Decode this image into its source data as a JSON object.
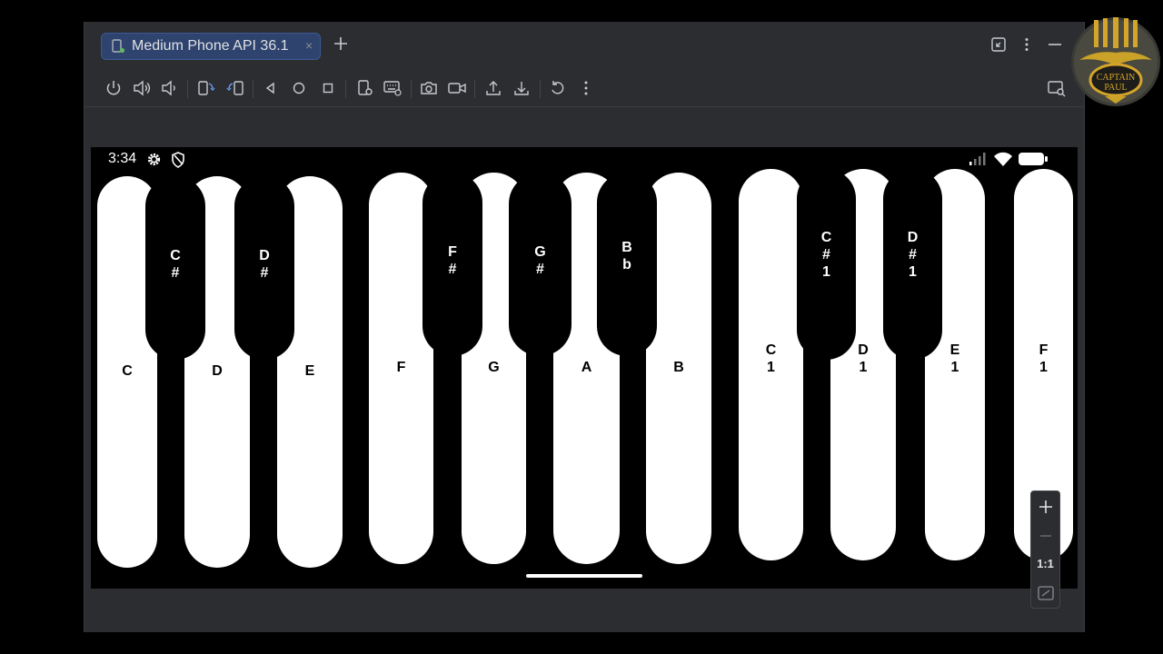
{
  "tab": {
    "title": "Medium Phone API 36.1",
    "close_glyph": "×",
    "add_glyph": "+"
  },
  "window_controls": [
    "restore-window-icon",
    "more-vert-icon",
    "minimize-icon"
  ],
  "toolbar": {
    "buttons": [
      "power-icon",
      "volume-up-icon",
      "volume-down-icon",
      "rotate-left-icon",
      "rotate-right-icon",
      "back-icon",
      "home-icon",
      "overview-icon",
      "device-settings-icon",
      "keyboard-icon",
      "camera-icon",
      "screen-record-icon",
      "export-icon",
      "import-icon",
      "reset-icon",
      "more-vert-icon",
      "device-mirroring-icon"
    ]
  },
  "status_bar": {
    "time": "3:34",
    "left_icons": [
      "settings-icon",
      "shield-icon"
    ],
    "right_icons": [
      "signal-icon",
      "wifi-icon",
      "battery-icon"
    ]
  },
  "piano": {
    "white_keys": [
      {
        "label": "C",
        "label_lines": [
          "C"
        ]
      },
      {
        "label": "D",
        "label_lines": [
          "D"
        ]
      },
      {
        "label": "E",
        "label_lines": [
          "E"
        ]
      },
      {
        "label": "F",
        "label_lines": [
          "F"
        ]
      },
      {
        "label": "G",
        "label_lines": [
          "G"
        ]
      },
      {
        "label": "A",
        "label_lines": [
          "A"
        ]
      },
      {
        "label": "B",
        "label_lines": [
          "B"
        ]
      },
      {
        "label": "C1",
        "label_lines": [
          "C",
          "1"
        ]
      },
      {
        "label": "D1",
        "label_lines": [
          "D",
          "1"
        ]
      },
      {
        "label": "E1",
        "label_lines": [
          "E",
          "1"
        ]
      },
      {
        "label": "F1",
        "label_lines": [
          "F",
          "1"
        ]
      }
    ],
    "black_keys": [
      {
        "label": "C#",
        "label_lines": [
          "C",
          "#"
        ]
      },
      {
        "label": "D#",
        "label_lines": [
          "D",
          "#"
        ]
      },
      {
        "label": "F#",
        "label_lines": [
          "F",
          "#"
        ]
      },
      {
        "label": "G#",
        "label_lines": [
          "G",
          "#"
        ]
      },
      {
        "label": "Bb",
        "label_lines": [
          "B",
          "b"
        ]
      },
      {
        "label": "C#1",
        "label_lines": [
          "C",
          "#",
          "1"
        ]
      },
      {
        "label": "D#1",
        "label_lines": [
          "D",
          "#",
          "1"
        ]
      }
    ]
  },
  "zoom_controls": {
    "zoom_in": "+",
    "zoom_out": "—",
    "actual_size": "1:1",
    "fit_icon": "fit-screen-icon"
  },
  "watermark": {
    "text_line1": "CAPTAIN",
    "text_line2": "PAUL"
  },
  "colors": {
    "tab_bg": "#2e436e",
    "window_bg": "#2b2d30",
    "key_white": "#ffffff",
    "key_black": "#000000"
  }
}
